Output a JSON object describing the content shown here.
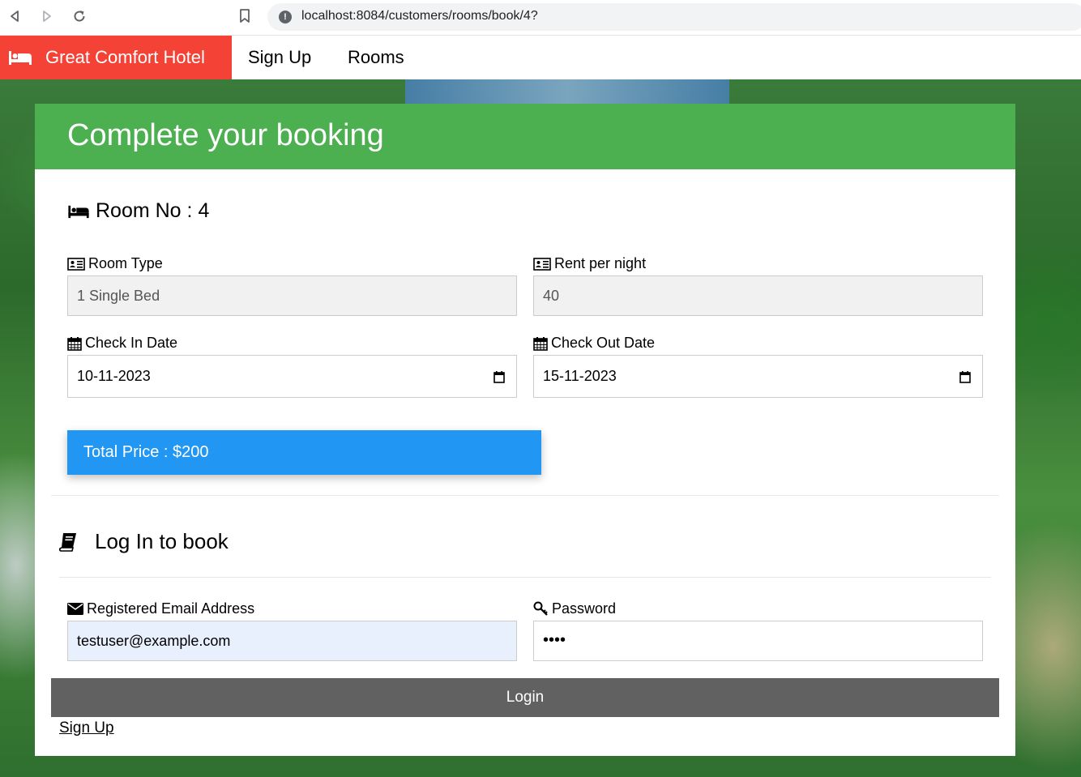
{
  "browser": {
    "url": "localhost:8084/customers/rooms/book/4?"
  },
  "nav": {
    "brand": "Great Comfort Hotel",
    "links": [
      "Sign Up",
      "Rooms"
    ]
  },
  "booking": {
    "title": "Complete your booking",
    "room_label": "Room No",
    "room_sep": " : ",
    "room_number": "4",
    "room_type_label": "Room Type",
    "room_type_value": "1 Single Bed",
    "rent_label": "Rent per night",
    "rent_value": "40",
    "check_in_label": "Check In Date",
    "check_in_value": "10-11-2023",
    "check_out_label": "Check Out Date",
    "check_out_value": "15-11-2023",
    "total_price": "Total Price : $200"
  },
  "login": {
    "title": "Log In to book",
    "email_label": "Registered Email Address",
    "email_value": "testuser@example.com",
    "password_label": "Password",
    "password_value": "••••",
    "button_label": "Login",
    "signup_link": "Sign Up"
  },
  "colors": {
    "brand": "#f44336",
    "header": "#4caf50",
    "price": "#2196f3",
    "login_button": "#616161"
  }
}
